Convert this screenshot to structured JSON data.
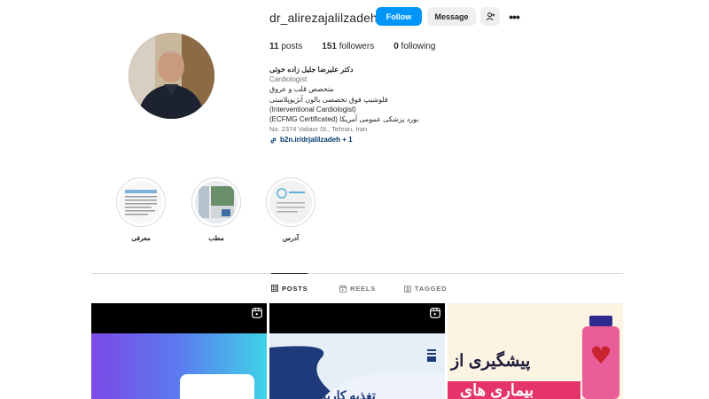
{
  "profile": {
    "username": "dr_alirezajalilzadeh",
    "follow_label": "Follow",
    "message_label": "Message",
    "more_glyph": "•••",
    "posts_count": "11",
    "posts_label": "posts",
    "followers_count": "151",
    "followers_label": "followers",
    "following_count": "0",
    "following_label": "following"
  },
  "bio": {
    "name": "دکتر علیرضا جلیل زاده خوئی",
    "category": "Cardiologist",
    "line1": "متخصص قلب و عروق",
    "line2": "فلوشیپ فوق تخصصی بالون آنژیوپلاستی",
    "line3": "(Interventional Cardiologist)",
    "line4": "بورد پزشکی عمومی آمریکا (ECFMG Certificated)",
    "address": "No. 2374 Valiasr St., Tehran, Iran",
    "link": "b2n.ir/drjalilzadeh + 1"
  },
  "highlights": [
    {
      "label": "معرفی"
    },
    {
      "label": "مطب"
    },
    {
      "label": "آدرس"
    }
  ],
  "tabs": {
    "posts": "POSTS",
    "reels": "REELS",
    "tagged": "TAGGED"
  },
  "posts": {
    "post3_text_line1": "پیشگیری از",
    "post3_text_line2": "بیماری های",
    "post2_text": "تغذیه کاربردی"
  },
  "colors": {
    "follow_button": "#0095f6",
    "link": "#00376b",
    "muted": "#737373"
  },
  "icons": {
    "suggest": "person-add-icon",
    "link": "link-icon",
    "posts_tab": "grid-icon",
    "reels_tab": "reels-icon",
    "tagged_tab": "tag-icon",
    "reel_badge": "reels-icon"
  }
}
